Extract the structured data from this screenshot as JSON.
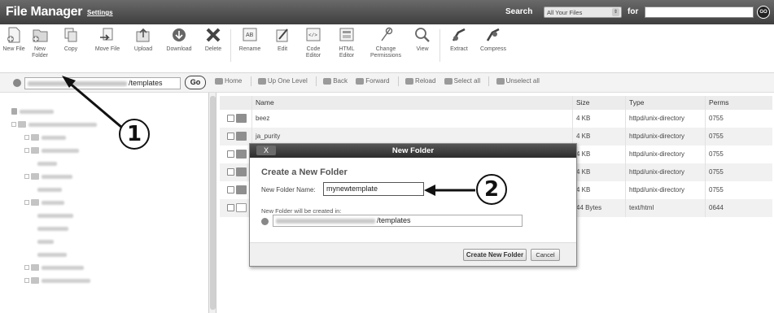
{
  "header": {
    "title": "File Manager",
    "settings_link": "Settings",
    "search_label": "Search",
    "search_scope": "All Your Files",
    "for_label": "for",
    "search_value": "",
    "go_label": "GO"
  },
  "toolbar": {
    "items": [
      {
        "label": "New File",
        "icon": "new-file-icon"
      },
      {
        "label": "New Folder",
        "icon": "new-folder-icon"
      },
      {
        "label": "Copy",
        "icon": "copy-icon"
      },
      {
        "label": "Move File",
        "icon": "move-file-icon"
      },
      {
        "label": "Upload",
        "icon": "upload-icon"
      },
      {
        "label": "Download",
        "icon": "download-icon"
      },
      {
        "label": "Delete",
        "icon": "delete-icon"
      },
      {
        "label": "Rename",
        "icon": "rename-icon"
      },
      {
        "label": "Edit",
        "icon": "edit-icon"
      },
      {
        "label": "Code Editor",
        "icon": "code-editor-icon"
      },
      {
        "label": "HTML Editor",
        "icon": "html-editor-icon"
      },
      {
        "label": "Change Permissions",
        "icon": "change-permissions-icon"
      },
      {
        "label": "View",
        "icon": "view-icon"
      },
      {
        "label": "Extract",
        "icon": "extract-icon"
      },
      {
        "label": "Compress",
        "icon": "compress-icon"
      }
    ]
  },
  "path_bar": {
    "path_suffix": "/templates",
    "go_label": "Go"
  },
  "nav": {
    "home": "Home",
    "up": "Up One Level",
    "back": "Back",
    "forward": "Forward",
    "reload": "Reload",
    "select_all": "Select all",
    "unselect_all": "Unselect all"
  },
  "tree": {
    "collapse_label": "Collapse all"
  },
  "table": {
    "columns": [
      "Name",
      "Size",
      "Type",
      "Perms"
    ],
    "rows": [
      {
        "name": "beez",
        "size": "4 KB",
        "type": "httpd/unix-directory",
        "perms": "0755",
        "kind": "folder"
      },
      {
        "name": "ja_purity",
        "size": "4 KB",
        "type": "httpd/unix-directory",
        "perms": "0755",
        "kind": "folder"
      },
      {
        "name": "",
        "size": "4 KB",
        "type": "httpd/unix-directory",
        "perms": "0755",
        "kind": "folder"
      },
      {
        "name": "",
        "size": "4 KB",
        "type": "httpd/unix-directory",
        "perms": "0755",
        "kind": "folder"
      },
      {
        "name": "",
        "size": "4 KB",
        "type": "httpd/unix-directory",
        "perms": "0755",
        "kind": "folder"
      },
      {
        "name": "",
        "size": "44 Bytes",
        "type": "text/html",
        "perms": "0644",
        "kind": "file"
      }
    ]
  },
  "dialog": {
    "title": "New Folder",
    "close": "X",
    "heading": "Create a New Folder",
    "name_label": "New Folder Name:",
    "name_value": "mynewtemplate",
    "location_label": "New Folder will be created in:",
    "location_suffix": "/templates",
    "create_button": "Create New Folder",
    "cancel_button": "Cancel"
  },
  "callouts": [
    "1",
    "2"
  ]
}
